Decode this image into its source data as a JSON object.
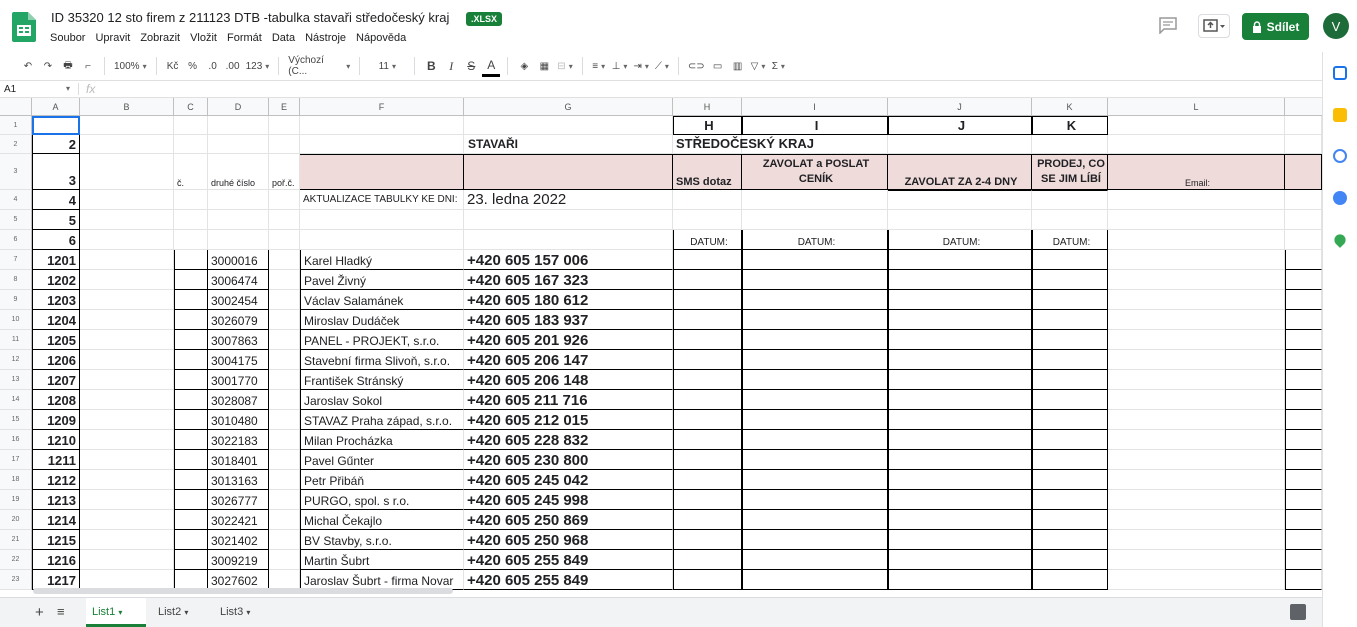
{
  "doc": {
    "title": "ID 35320 12 sto firem z 211123 DTB -tabulka stavaři středočeský kraj",
    "badge": ".XLSX"
  },
  "menu": [
    "Soubor",
    "Upravit",
    "Zobrazit",
    "Vložit",
    "Formát",
    "Data",
    "Nástroje",
    "Nápověda"
  ],
  "share_label": "Sdílet",
  "avatar_letter": "V",
  "toolbar": {
    "zoom": "100%",
    "currency": "Kč",
    "percent": "%",
    "dec_less": ".0",
    "dec_more": ".00",
    "format123": "123",
    "font": "Výchozí (C...",
    "size": "11"
  },
  "formula": {
    "cellref": "A1",
    "fx": "fx"
  },
  "columns": [
    "A",
    "B",
    "C",
    "D",
    "E",
    "F",
    "G",
    "H",
    "I",
    "J",
    "K",
    "L"
  ],
  "row_numbers": [
    "1",
    "2",
    "3",
    "4",
    "5",
    "6",
    "7",
    "8",
    "9",
    "10",
    "11",
    "12",
    "13",
    "14",
    "15",
    "16",
    "17",
    "18",
    "19",
    "20",
    "21",
    "22",
    "23"
  ],
  "sheet": {
    "r1": {
      "H": "H",
      "I": "I",
      "J": "J",
      "K": "K"
    },
    "r2": {
      "A": "2",
      "G": "STAVAŘI",
      "H": "STŘEDOČESKÝ KRAJ"
    },
    "r3": {
      "A": "3",
      "C": "č.",
      "D": "druhé číslo",
      "E": "poř.č.",
      "H": "SMS dotaz",
      "I": "ZAVOLAT a POSLAT CENÍK",
      "J": "ZAVOLAT ZA 2-4 DNY",
      "K": "PRODEJ, CO SE JIM LÍBÍ",
      "L": "Email:"
    },
    "r4": {
      "A": "4",
      "F": "AKTUALIZACE TABULKY KE DNI:",
      "G": "23. ledna 2022"
    },
    "r5": {
      "A": "5"
    },
    "r6": {
      "A": "6",
      "H": "DATUM:",
      "I": "DATUM:",
      "J": "DATUM:",
      "K": "DATUM:"
    },
    "data": [
      {
        "A": "1201",
        "D": "3000016",
        "F": "Karel Hladký",
        "G": "+420 605 157 006"
      },
      {
        "A": "1202",
        "D": "3006474",
        "F": "Pavel Živný",
        "G": "+420 605 167 323"
      },
      {
        "A": "1203",
        "D": "3002454",
        "F": "Václav Salamánek",
        "G": "+420 605 180 612"
      },
      {
        "A": "1204",
        "D": "3026079",
        "F": "Miroslav Dudáček",
        "G": "+420 605 183 937"
      },
      {
        "A": "1205",
        "D": "3007863",
        "F": "PANEL - PROJEKT, s.r.o.",
        "G": "+420 605 201 926"
      },
      {
        "A": "1206",
        "D": "3004175",
        "F": "Stavební firma Slivoň, s.r.o.",
        "G": "+420 605 206 147"
      },
      {
        "A": "1207",
        "D": "3001770",
        "F": "František Stránský",
        "G": "+420 605 206 148"
      },
      {
        "A": "1208",
        "D": "3028087",
        "F": "Jaroslav Sokol",
        "G": "+420 605 211 716"
      },
      {
        "A": "1209",
        "D": "3010480",
        "F": "STAVAZ Praha západ, s.r.o.",
        "G": "+420 605 212 015"
      },
      {
        "A": "1210",
        "D": "3022183",
        "F": "Milan Procházka",
        "G": "+420 605 228 832"
      },
      {
        "A": "1211",
        "D": "3018401",
        "F": "Pavel Gűnter",
        "G": "+420 605 230 800"
      },
      {
        "A": "1212",
        "D": "3013163",
        "F": "Petr Přibáň",
        "G": "+420 605 245 042"
      },
      {
        "A": "1213",
        "D": "3026777",
        "F": "PURGO, spol. s r.o.",
        "G": "+420 605 245 998"
      },
      {
        "A": "1214",
        "D": "3022421",
        "F": "Michal Čekajlo",
        "G": "+420 605 250 869"
      },
      {
        "A": "1215",
        "D": "3021402",
        "F": "BV Stavby, s.r.o.",
        "G": "+420 605 250 968"
      },
      {
        "A": "1216",
        "D": "3009219",
        "F": "Martin Šubrt",
        "G": "+420 605 255 849"
      },
      {
        "A": "1217",
        "D": "3027602",
        "F": "Jaroslav Šubrt - firma Novar",
        "G": "+420 605 255 849"
      }
    ]
  },
  "tabs": [
    "List1",
    "List2",
    "List3"
  ]
}
